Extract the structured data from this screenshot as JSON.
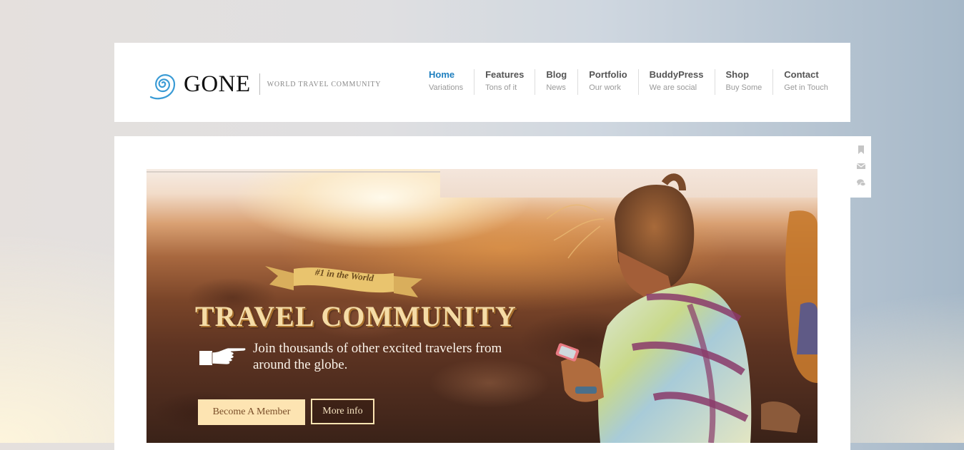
{
  "brand": {
    "name": "GONE",
    "tagline": "WORLD TRAVEL COMMUNITY",
    "accent_color": "#3a9bd5",
    "logo_icon": "spiral-icon"
  },
  "nav": {
    "items": [
      {
        "label": "Home",
        "sub": "Variations",
        "active": true
      },
      {
        "label": "Features",
        "sub": "Tons of it"
      },
      {
        "label": "Blog",
        "sub": "News"
      },
      {
        "label": "Portfolio",
        "sub": "Our work"
      },
      {
        "label": "BuddyPress",
        "sub": "We are social"
      },
      {
        "label": "Shop",
        "sub": "Buy Some"
      },
      {
        "label": "Contact",
        "sub": "Get in Touch"
      }
    ],
    "active_color": "#1e7fbf"
  },
  "side_tools": [
    {
      "icon": "bookmark-icon"
    },
    {
      "icon": "envelope-icon"
    },
    {
      "icon": "comments-icon"
    }
  ],
  "hero": {
    "ribbon_text": "#1 in the World",
    "title": "TRAVEL COMMUNITY",
    "description": "Join thousands of other excited travelers from around the globe.",
    "pointer_icon": "pointing-hand-icon",
    "primary_button": "Become A Member",
    "secondary_button": "More info",
    "button_color": "#fde4b2"
  }
}
